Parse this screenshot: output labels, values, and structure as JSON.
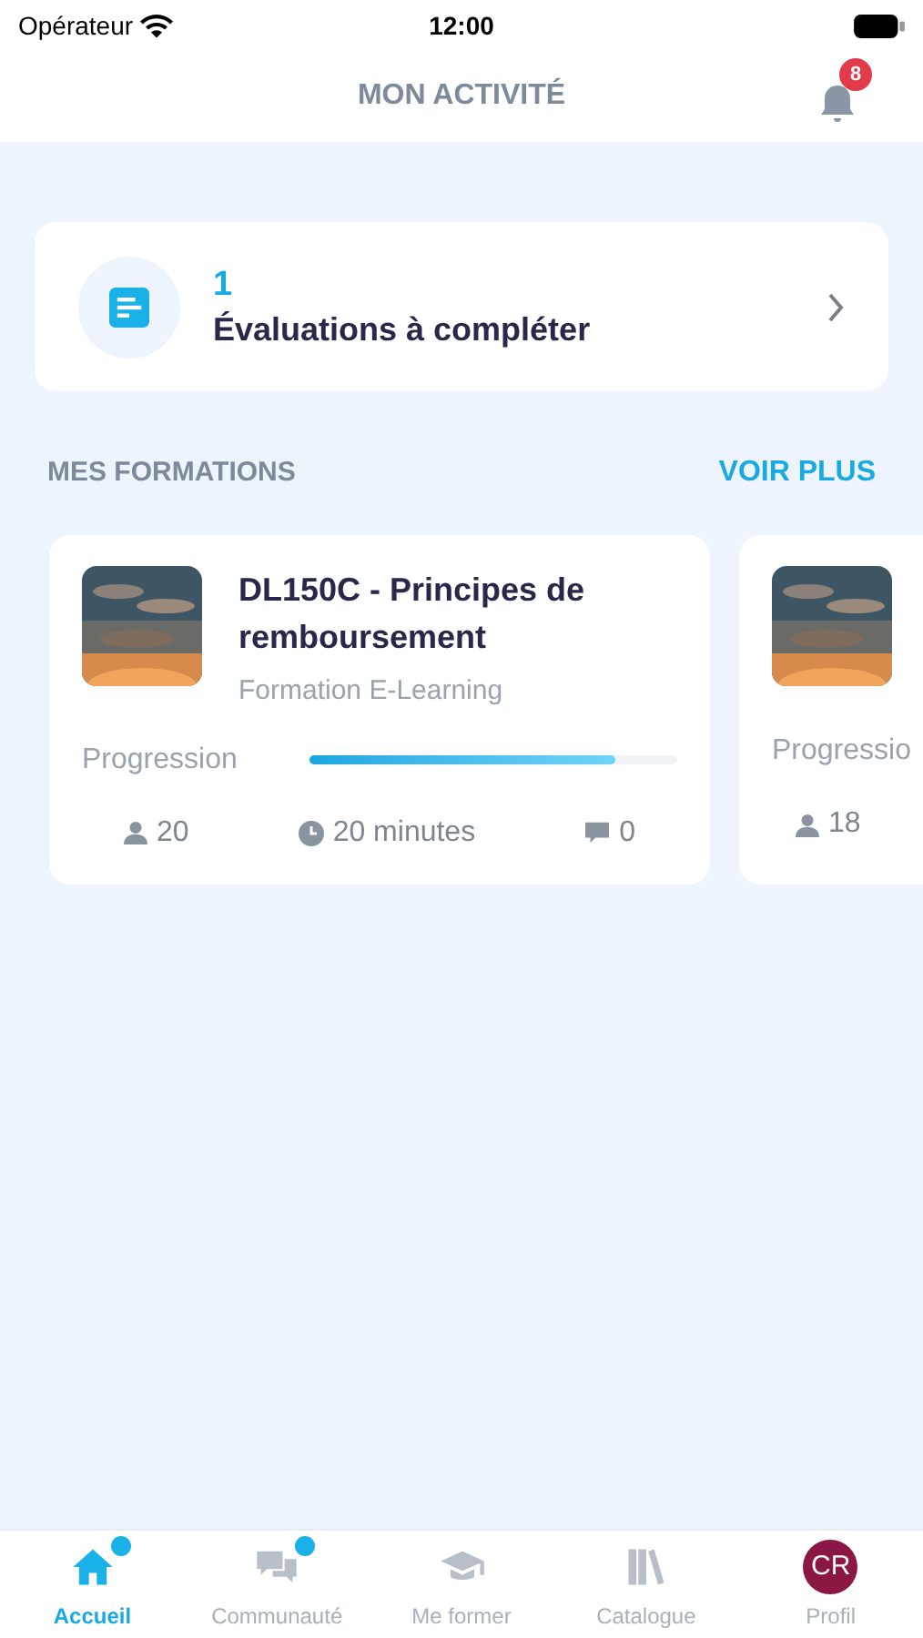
{
  "status_bar": {
    "carrier": "Opérateur",
    "time": "12:00"
  },
  "header": {
    "title": "MON ACTIVITÉ",
    "notifications": "8"
  },
  "evaluations": {
    "count": "1",
    "label": "Évaluations à compléter"
  },
  "section": {
    "title": "MES FORMATIONS",
    "link": "VOIR PLUS"
  },
  "courses": [
    {
      "title": "DL150C - Principes de remboursement",
      "type": "Formation E-Learning",
      "progress_label": "Progression",
      "level": 0.83,
      "learners": "20",
      "duration": "20 minutes",
      "comments": "0"
    },
    {
      "progress_label": "Progressio",
      "learners": "18"
    }
  ],
  "tabs": [
    {
      "kind": "home",
      "label": "Accueil",
      "selected": true,
      "dot": true
    },
    {
      "kind": "community",
      "label": "Communauté",
      "selected": false,
      "dot": true
    },
    {
      "kind": "learn",
      "label": "Me former",
      "selected": false,
      "dot": false
    },
    {
      "kind": "catalog",
      "label": "Catalogue",
      "selected": false,
      "dot": false
    },
    {
      "kind": "profile",
      "label": "Profil",
      "selected": false,
      "dot": false,
      "initials": "CR"
    }
  ]
}
